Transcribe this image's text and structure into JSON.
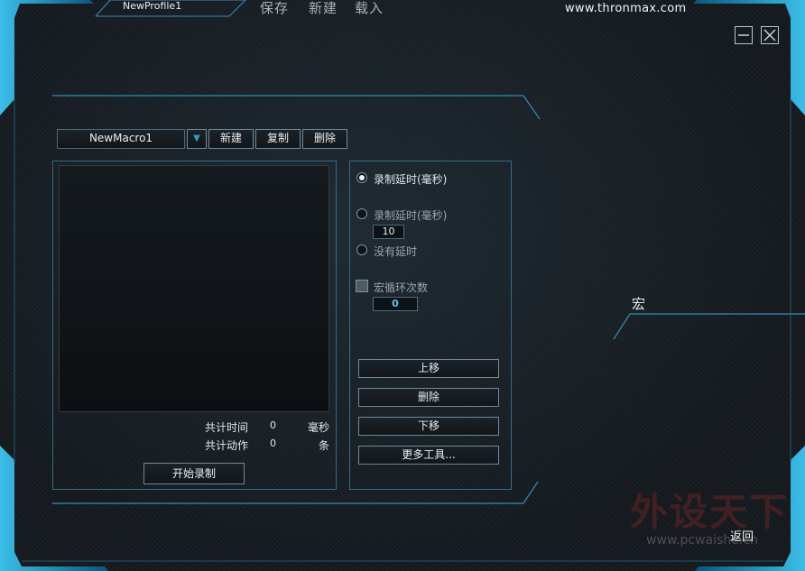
{
  "header": {
    "profile_name": "NewProfile1",
    "menu": [
      "保存",
      "新建",
      "载入"
    ],
    "site_url": "www.thronmax.com"
  },
  "window_controls": {
    "minimize": "minimize-icon",
    "close": "close-icon"
  },
  "macro_bar": {
    "selected_macro": "NewMacro1",
    "dropdown_icon": "▼",
    "new_label": "新建",
    "copy_label": "复制",
    "delete_label": "删除"
  },
  "recorder": {
    "total_time_label": "共计时间",
    "total_time_value": "0",
    "total_time_unit": "毫秒",
    "total_actions_label": "共计动作",
    "total_actions_value": "0",
    "total_actions_unit": "条",
    "start_label": "开始录制"
  },
  "options": {
    "record_delay_label": "录制延时(毫秒)",
    "custom_delay_label": "录制延时(毫秒)",
    "custom_delay_value": "10",
    "no_delay_label": "没有延时",
    "loop_label": "宏循环次数",
    "loop_value": "0",
    "selected": "record_delay",
    "loop_checked": false
  },
  "actions": {
    "move_up": "上移",
    "delete": "删除",
    "move_down": "下移",
    "more_tools": "更多工具..."
  },
  "side": {
    "section_label": "宏",
    "back_label": "返回"
  },
  "watermark": {
    "text": "外设天下",
    "url": "www.pcwaishe.cn"
  },
  "colors": {
    "accent": "#2a9fd0",
    "frame_glow": "#1fb8f0",
    "panel_border": "#2f6f86"
  }
}
